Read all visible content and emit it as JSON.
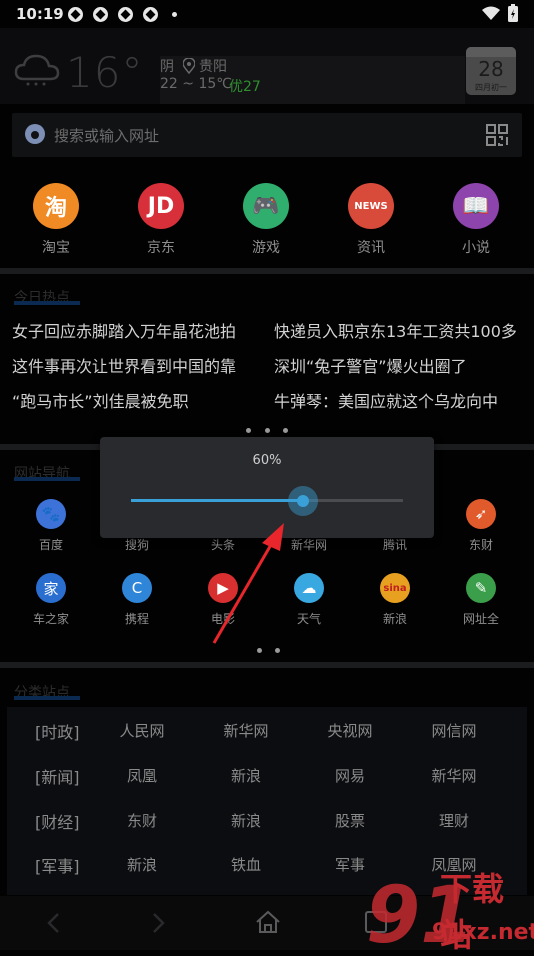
{
  "status_bar": {
    "time": "10:19"
  },
  "weather": {
    "temperature": "16°",
    "condition": "阴",
    "city": "贵阳",
    "range": "22 ~ 15℃",
    "aqi": "优27",
    "calendar_day": "28",
    "calendar_lunar": "四月初一"
  },
  "search": {
    "placeholder": "搜索或输入网址"
  },
  "shortcuts": [
    {
      "label": "淘宝",
      "glyph": "淘",
      "color": "#f08a24"
    },
    {
      "label": "京东",
      "glyph": "JD",
      "color": "#d8303a"
    },
    {
      "label": "游戏",
      "glyph": "🎮",
      "color": "#2fae6e"
    },
    {
      "label": "资讯",
      "glyph": "NEWS",
      "color": "#d84a3a"
    },
    {
      "label": "小说",
      "glyph": "📖",
      "color": "#8e44ad"
    }
  ],
  "hot": {
    "title": "今日热点",
    "left": [
      "女子回应赤脚踏入万年晶花池拍",
      "这件事再次让世界看到中国的靠",
      "“跑马市长”刘佳晨被免职"
    ],
    "right": [
      "快递员入职京东13年工资共100多",
      "深圳“兔子警官”爆火出圈了",
      "牛弹琴：美国应就这个乌龙向中"
    ]
  },
  "nav": {
    "title": "网站导航",
    "row1": [
      {
        "label": "百度",
        "glyph": "🐾",
        "color": "#3d73d8"
      },
      {
        "label": "搜狗",
        "glyph": "",
        "color": ""
      },
      {
        "label": "头条",
        "glyph": "",
        "color": ""
      },
      {
        "label": "新华网",
        "glyph": "",
        "color": ""
      },
      {
        "label": "腾讯",
        "glyph": "",
        "color": ""
      },
      {
        "label": "东财",
        "glyph": "➶",
        "color": "#e05a2b"
      }
    ],
    "row2": [
      {
        "label": "车之家",
        "glyph": "家",
        "color": "#2a6fd0"
      },
      {
        "label": "携程",
        "glyph": "C",
        "color": "#2f86d8"
      },
      {
        "label": "电影",
        "glyph": "▶",
        "color": "#d83030"
      },
      {
        "label": "天气",
        "glyph": "☁",
        "color": "#3aa8e0"
      },
      {
        "label": "新浪",
        "glyph": "sina",
        "color": "#e8a020"
      },
      {
        "label": "网址全",
        "glyph": "✎",
        "color": "#3a9e4a"
      }
    ]
  },
  "categories": {
    "title": "分类站点",
    "rows": [
      {
        "head": "[时政]",
        "items": [
          "人民网",
          "新华网",
          "央视网",
          "网信网"
        ]
      },
      {
        "head": "[新闻]",
        "items": [
          "凤凰",
          "新浪",
          "网易",
          "新华网"
        ]
      },
      {
        "head": "[财经]",
        "items": [
          "东财",
          "新浪",
          "股票",
          "理财"
        ]
      },
      {
        "head": "[军事]",
        "items": [
          "新浪",
          "铁血",
          "军事",
          "凤凰网"
        ]
      }
    ]
  },
  "dialog": {
    "value_label": "60%",
    "level": 0.6
  },
  "watermark": {
    "text": "下载站",
    "url": "91xz.net"
  }
}
